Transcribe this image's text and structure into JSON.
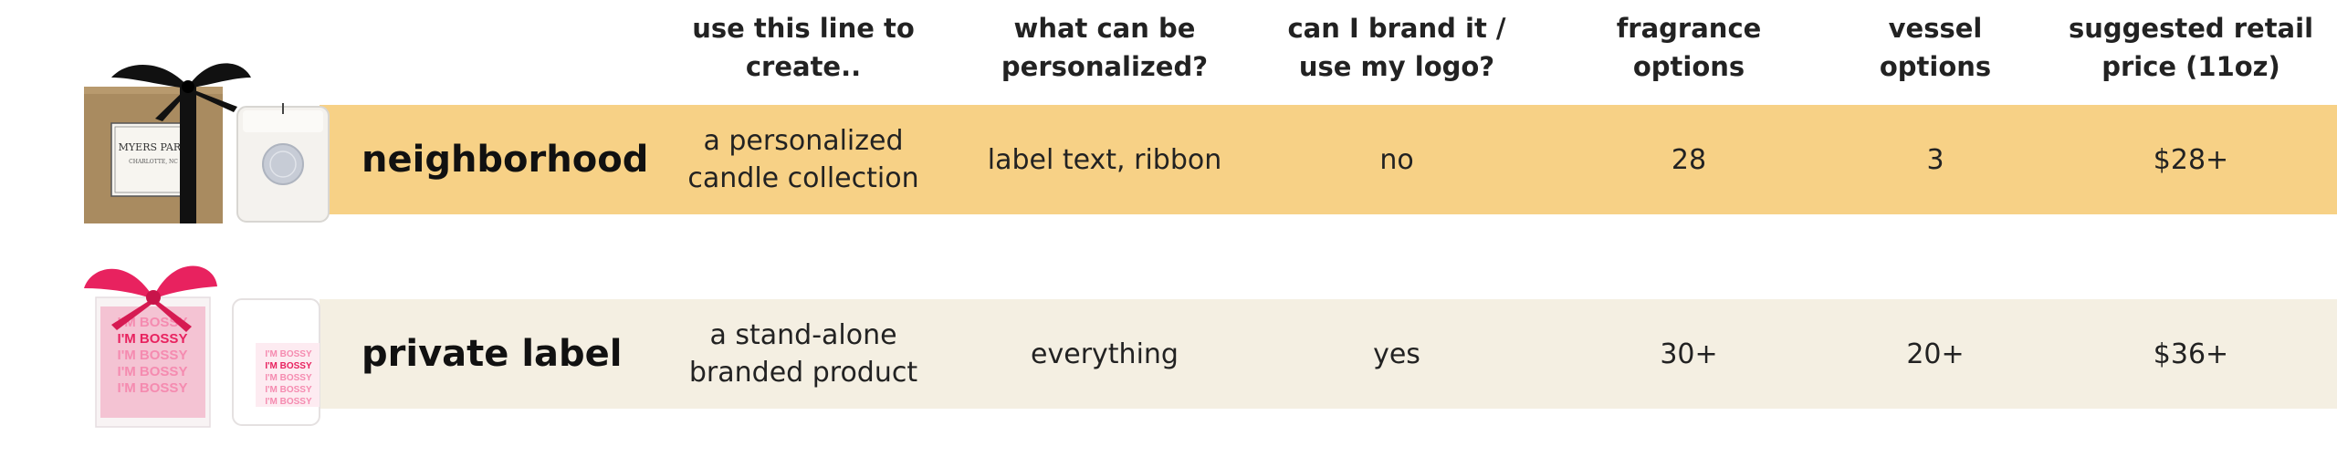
{
  "headers": {
    "use_line": [
      "use this line to",
      "create.."
    ],
    "personalized": [
      "what can be",
      "personalized?"
    ],
    "brand": [
      "can I brand it /",
      "use my logo?"
    ],
    "fragrance": [
      "fragrance",
      "options"
    ],
    "vessel": [
      "vessel",
      "options"
    ],
    "price": [
      "suggested retail",
      "price (11oz)"
    ]
  },
  "rows": [
    {
      "name": "neighborhood",
      "use_line": [
        "a personalized",
        "candle collection"
      ],
      "personalized": "label text, ribbon",
      "brand": "no",
      "fragrance": "28",
      "vessel": "3",
      "price": "$28+",
      "box_label": [
        "MYERS PARK",
        "CHARLOTTE, NC"
      ]
    },
    {
      "name": "private label",
      "use_line": [
        "a stand-alone",
        "branded product"
      ],
      "personalized": "everything",
      "brand": "yes",
      "fragrance": "30+",
      "vessel": "20+",
      "price": "$36+",
      "box_label": [
        "I'M BOSSY",
        "I'M BOSSY",
        "I'M BOSSY",
        "I'M BOSSY",
        "I'M BOSSY"
      ]
    }
  ],
  "colors": {
    "neighborhood_band": "#f7d186",
    "private_label_band": "#f4efe2",
    "ribbon_black": "#111111",
    "ribbon_pink": "#e8225f",
    "kraft_box": "#a98b60"
  }
}
